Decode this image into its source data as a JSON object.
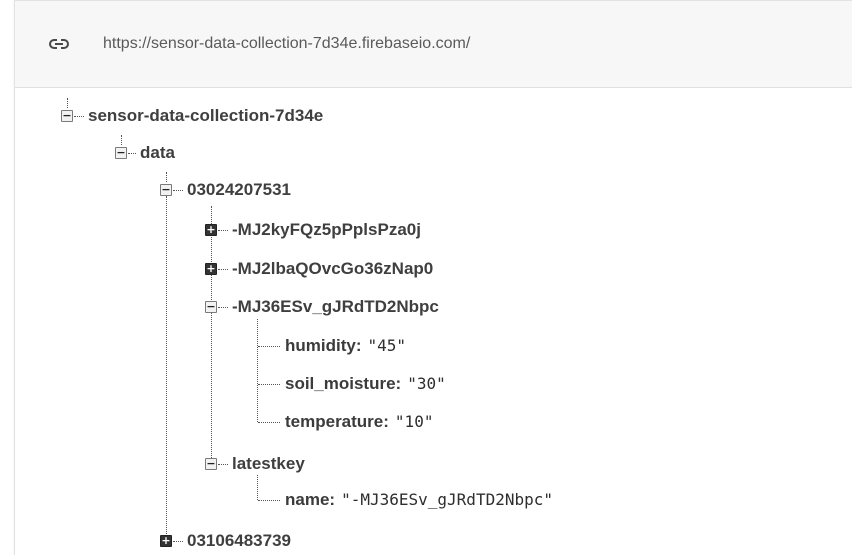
{
  "url": "https://sensor-data-collection-7d34e.firebaseio.com/",
  "tree": {
    "root": "sensor-data-collection-7d34e",
    "data": "data",
    "device1": "03024207531",
    "entry1": "-MJ2kyFQz5pPplsPza0j",
    "entry2": "-MJ2lbaQOvcGo36zNap0",
    "entry3": "-MJ36ESv_gJRdTD2Nbpc",
    "humidity_key": "humidity:",
    "humidity_val": "\"45\"",
    "soil_key": "soil_moisture:",
    "soil_val": "\"30\"",
    "temp_key": "temperature:",
    "temp_val": "\"10\"",
    "latestkey": "latestkey",
    "name_key": "name:",
    "name_val": "\"-MJ36ESv_gJRdTD2Nbpc\"",
    "device2": "03106483739"
  },
  "icons": {
    "link": "link-icon",
    "expand": "plus-box-icon",
    "collapse": "minus-box-icon"
  }
}
